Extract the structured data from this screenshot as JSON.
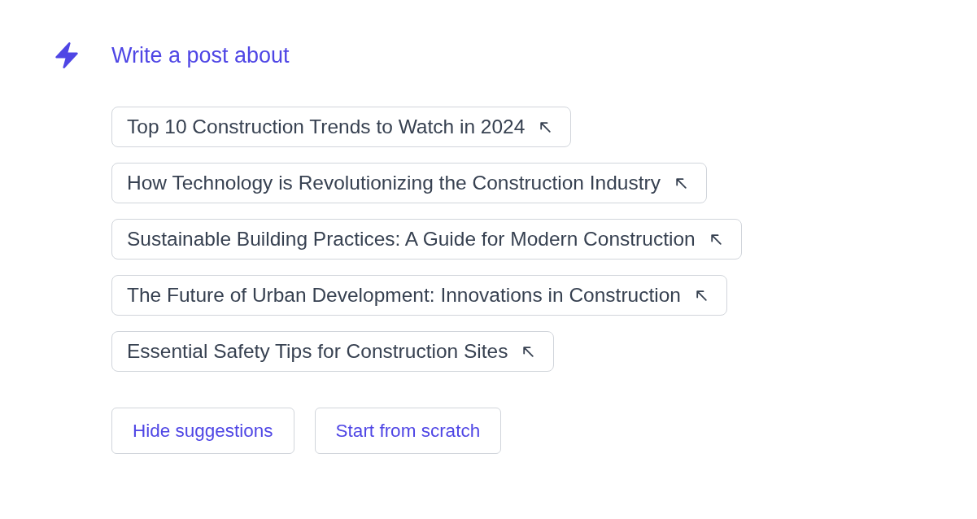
{
  "heading": {
    "title": "Write a post about"
  },
  "suggestions": [
    {
      "label": "Top 10 Construction Trends to Watch in 2024"
    },
    {
      "label": "How Technology is Revolutionizing the Construction Industry"
    },
    {
      "label": "Sustainable Building Practices: A Guide for Modern Construction"
    },
    {
      "label": "The Future of Urban Development: Innovations in Construction"
    },
    {
      "label": "Essential Safety Tips for Construction Sites"
    }
  ],
  "buttons": [
    {
      "label": "Hide suggestions"
    },
    {
      "label": "Start from scratch"
    }
  ]
}
